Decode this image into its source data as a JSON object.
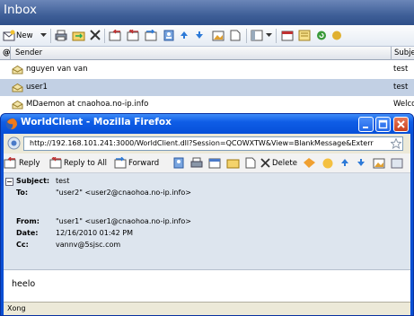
{
  "inbox": {
    "title": "Inbox",
    "toolbar": {
      "new_label": "New"
    },
    "columns": {
      "attach": "@",
      "sender": "Sender",
      "subject": "Subje"
    },
    "rows": [
      {
        "sender": "nguyen van van",
        "subject": "test"
      },
      {
        "sender": "user1",
        "subject": "test"
      },
      {
        "sender": "MDaemon at cnaohoa.no-ip.info",
        "subject": "Welco"
      }
    ]
  },
  "browser": {
    "title": "WorldClient - Mozilla Firefox",
    "url": "http://192.168.101.241:3000/WorldClient.dll?Session=QCOWXTW&View=BlankMessage&Exterr",
    "toolbar": {
      "reply": "Reply",
      "reply_all": "Reply to All",
      "forward": "Forward",
      "delete": "Delete"
    },
    "message": {
      "subject_label": "Subject:",
      "subject_value": "test",
      "to_label": "To:",
      "to_value": "\"user2\" <user2@cnaohoa.no-ip.info>",
      "from_label": "From:",
      "from_value": "\"user1\" <user1@cnaohoa.no-ip.info>",
      "date_label": "Date:",
      "date_value": "12/16/2010 01:42 PM",
      "cc_label": "Cc:",
      "cc_value": "vannv@5sjsc.com",
      "body": "heelo"
    },
    "status": "Xong"
  },
  "colors": {
    "title_bar": "#3f5f98",
    "xp_blue": "#0a4fd4",
    "selected_row": "#c2d0e4",
    "header_bg": "#dde5ee"
  }
}
